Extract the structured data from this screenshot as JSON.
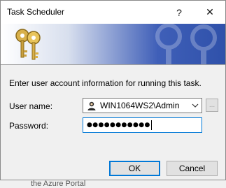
{
  "window": {
    "title": "Task Scheduler",
    "help_glyph": "?",
    "close_glyph": "✕"
  },
  "form": {
    "instruction": "Enter user account information for running this task.",
    "user_label": "User name:",
    "user_value": "WIN1064WS2\\Admin",
    "password_label": "Password:",
    "password_masked": "●●●●●●●●●●●",
    "browse_label": "..."
  },
  "buttons": {
    "ok": "OK",
    "cancel": "Cancel"
  },
  "background_text": "the Azure Portal",
  "colors": {
    "focus_border": "#0078d7",
    "banner_blue": "#2f51aa"
  }
}
